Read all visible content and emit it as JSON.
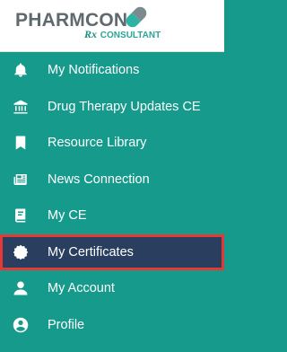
{
  "brand": {
    "name": "PHARMCON",
    "rx": "Rx",
    "sub": "CONSULTANT"
  },
  "colors": {
    "sidebar_bg": "#159a8c",
    "active_bg": "#2a3f5f",
    "highlight_border": "#e53935"
  },
  "nav": {
    "items": [
      {
        "label": "My Notifications",
        "icon": "bell-icon"
      },
      {
        "label": "Drug Therapy Updates CE",
        "icon": "institution-icon"
      },
      {
        "label": "Resource Library",
        "icon": "bookmark-icon"
      },
      {
        "label": "News Connection",
        "icon": "newspaper-icon"
      },
      {
        "label": "My CE",
        "icon": "book-icon"
      },
      {
        "label": "My Certificates",
        "icon": "certificate-icon",
        "active": true
      },
      {
        "label": "My Account",
        "icon": "user-icon"
      },
      {
        "label": "Profile",
        "icon": "user-circle-icon"
      }
    ]
  }
}
